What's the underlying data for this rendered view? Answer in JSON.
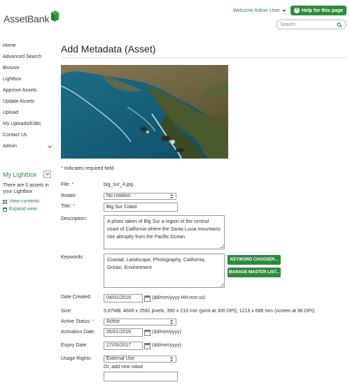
{
  "app": {
    "logo_text": "AssetBank",
    "welcome": "Welcome Admin User",
    "help_label": "Help for this page",
    "search_placeholder": "Search"
  },
  "sidebar": {
    "items": [
      {
        "label": "Home"
      },
      {
        "label": "Advanced Search"
      },
      {
        "label": "Browse"
      },
      {
        "label": "Lightbox"
      },
      {
        "label": "Approve Assets"
      },
      {
        "label": "Update Assets"
      },
      {
        "label": "Upload"
      },
      {
        "label": "My Uploads/Edits"
      },
      {
        "label": "Contact Us"
      },
      {
        "label": "Admin"
      }
    ],
    "lightbox": {
      "title": "My Lightbox",
      "text": "There are 0 assets in your Lightbox",
      "view_contents": "View contents",
      "expand_view": "Expand view"
    }
  },
  "page": {
    "title": "Add Metadata (Asset)",
    "required_note": "Indicates required field."
  },
  "form": {
    "file_label": "File:",
    "file_value": "big_sur_4.jpg",
    "rotate_label": "Rotate:",
    "rotate_value": "No rotation",
    "title_label": "Title:",
    "title_value": "Big Sur Coast",
    "description_label": "Description:",
    "description_value": "A photo taken of Big Sur a region of the central coast of California where the Santa Lucia mountains rise abruptly from the Pacific Ocean.",
    "keywords_label": "Keywords:",
    "keywords_value": "Coastal, Landscape, Photography, California, Ocean, Environment",
    "keyword_chooser": "KEYWORD CHOOSER...",
    "manage_master": "MANAGE MASTER LIST...",
    "date_created_label": "Date Created:",
    "date_created_value": "04/01/2016",
    "date_created_hint": "(dd/mm/yyyy HH:mm:ss)",
    "size_label": "Size:",
    "size_value": "5.87MB; 4608 x 2592 pixels; 390 x 219 mm (print at 300 DPI); 1219 x 686 mm (screen at 96 DPI);",
    "active_status_label": "Active Status:",
    "active_status_value": "Active",
    "activation_date_label": "Activation Date:",
    "activation_date_value": "05/01/2016",
    "activation_date_hint": "(dd/mm/yyyy)",
    "expiry_date_label": "Expiry Date:",
    "expiry_date_value": "17/05/2017",
    "expiry_date_hint": "(dd/mm/yyyy)",
    "usage_rights_label": "Usage Rights:",
    "usage_rights_value": "External Use",
    "add_new_label": "Or, add new value",
    "add_new_value": ""
  },
  "colors": {
    "accent": "#2e8b3c"
  }
}
